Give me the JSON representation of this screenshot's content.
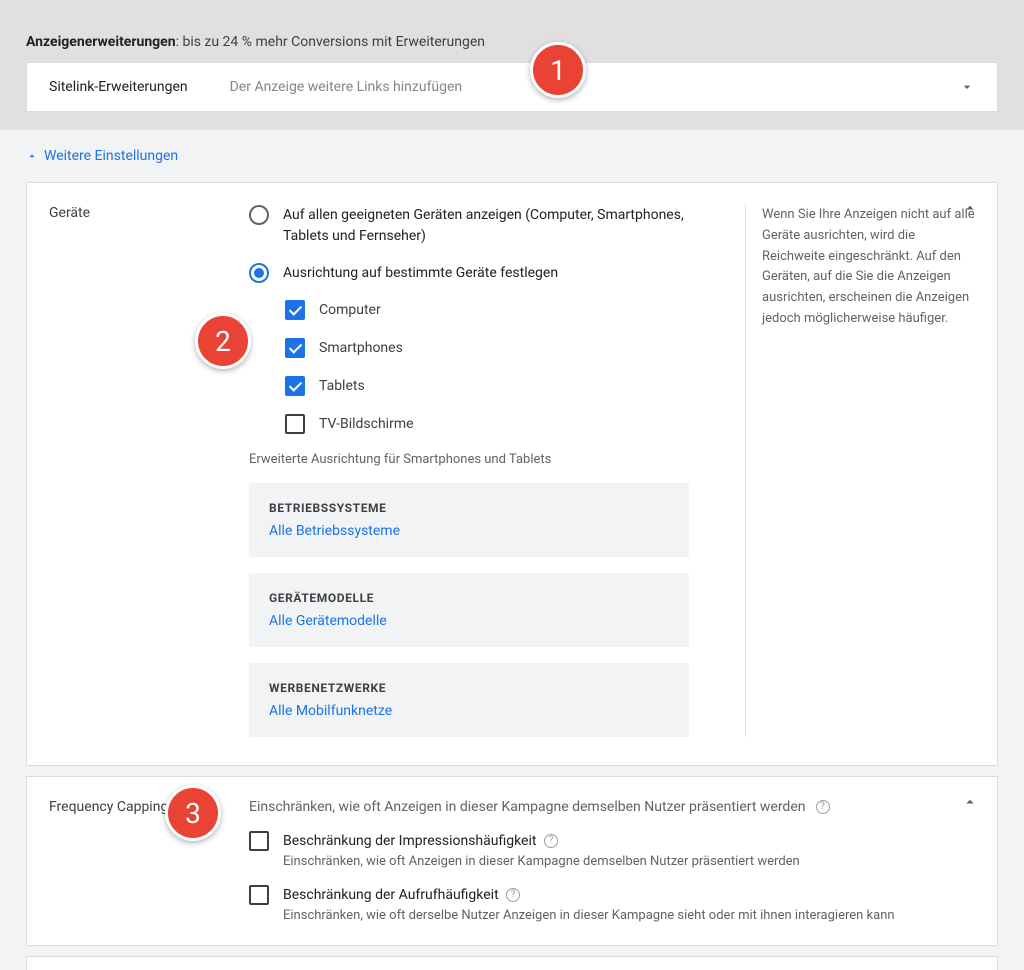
{
  "extensions": {
    "header_bold": "Anzeigenerweiterungen",
    "header_rest": ": bis zu 24 % mehr Conversions mit Erweiterungen",
    "row_type": "Sitelink-Erweiterungen",
    "row_desc": "Der Anzeige weitere Links hinzufügen"
  },
  "more_settings": "Weitere Einstellungen",
  "devices": {
    "title": "Geräte",
    "radio_all": "Auf allen geeigneten Geräten anzeigen (Computer, Smartphones, Tablets und Fernseher)",
    "radio_specific": "Ausrichtung auf bestimmte Geräte festlegen",
    "cb_computer": "Computer",
    "cb_smartphones": "Smartphones",
    "cb_tablets": "Tablets",
    "cb_tv": "TV-Bildschirme",
    "advanced_note": "Erweiterte Ausrichtung für Smartphones und Tablets",
    "panel_os_title": "BETRIEBSSYSTEME",
    "panel_os_link": "Alle Betriebssysteme",
    "panel_model_title": "GERÄTEMODELLE",
    "panel_model_link": "Alle Gerätemodelle",
    "panel_net_title": "WERBENETZWERKE",
    "panel_net_link": "Alle Mobilfunknetze",
    "help_text": "Wenn Sie Ihre Anzeigen nicht auf alle Geräte ausrichten, wird die Reichweite eingeschränkt. Auf den Geräten, auf die Sie die Anzeigen ausrichten, erscheinen die Anzeigen jedoch möglicherweise häufiger."
  },
  "freq": {
    "title": "Frequency Capping",
    "desc": "Einschränken, wie oft Anzeigen in dieser Kampagne demselben Nutzer präsentiert werden",
    "chk1_label": "Beschränkung der Impressionshäufigkeit",
    "chk1_sub": "Einschränken, wie oft Anzeigen in dieser Kampagne demselben Nutzer präsentiert werden",
    "chk2_label": "Beschränkung der Aufrufhäufigkeit",
    "chk2_sub": "Einschränken, wie oft derselbe Nutzer Anzeigen in dieser Kampagne sieht oder mit ihnen interagieren kann"
  },
  "badges": {
    "b1": "1",
    "b2": "2",
    "b3": "3"
  }
}
